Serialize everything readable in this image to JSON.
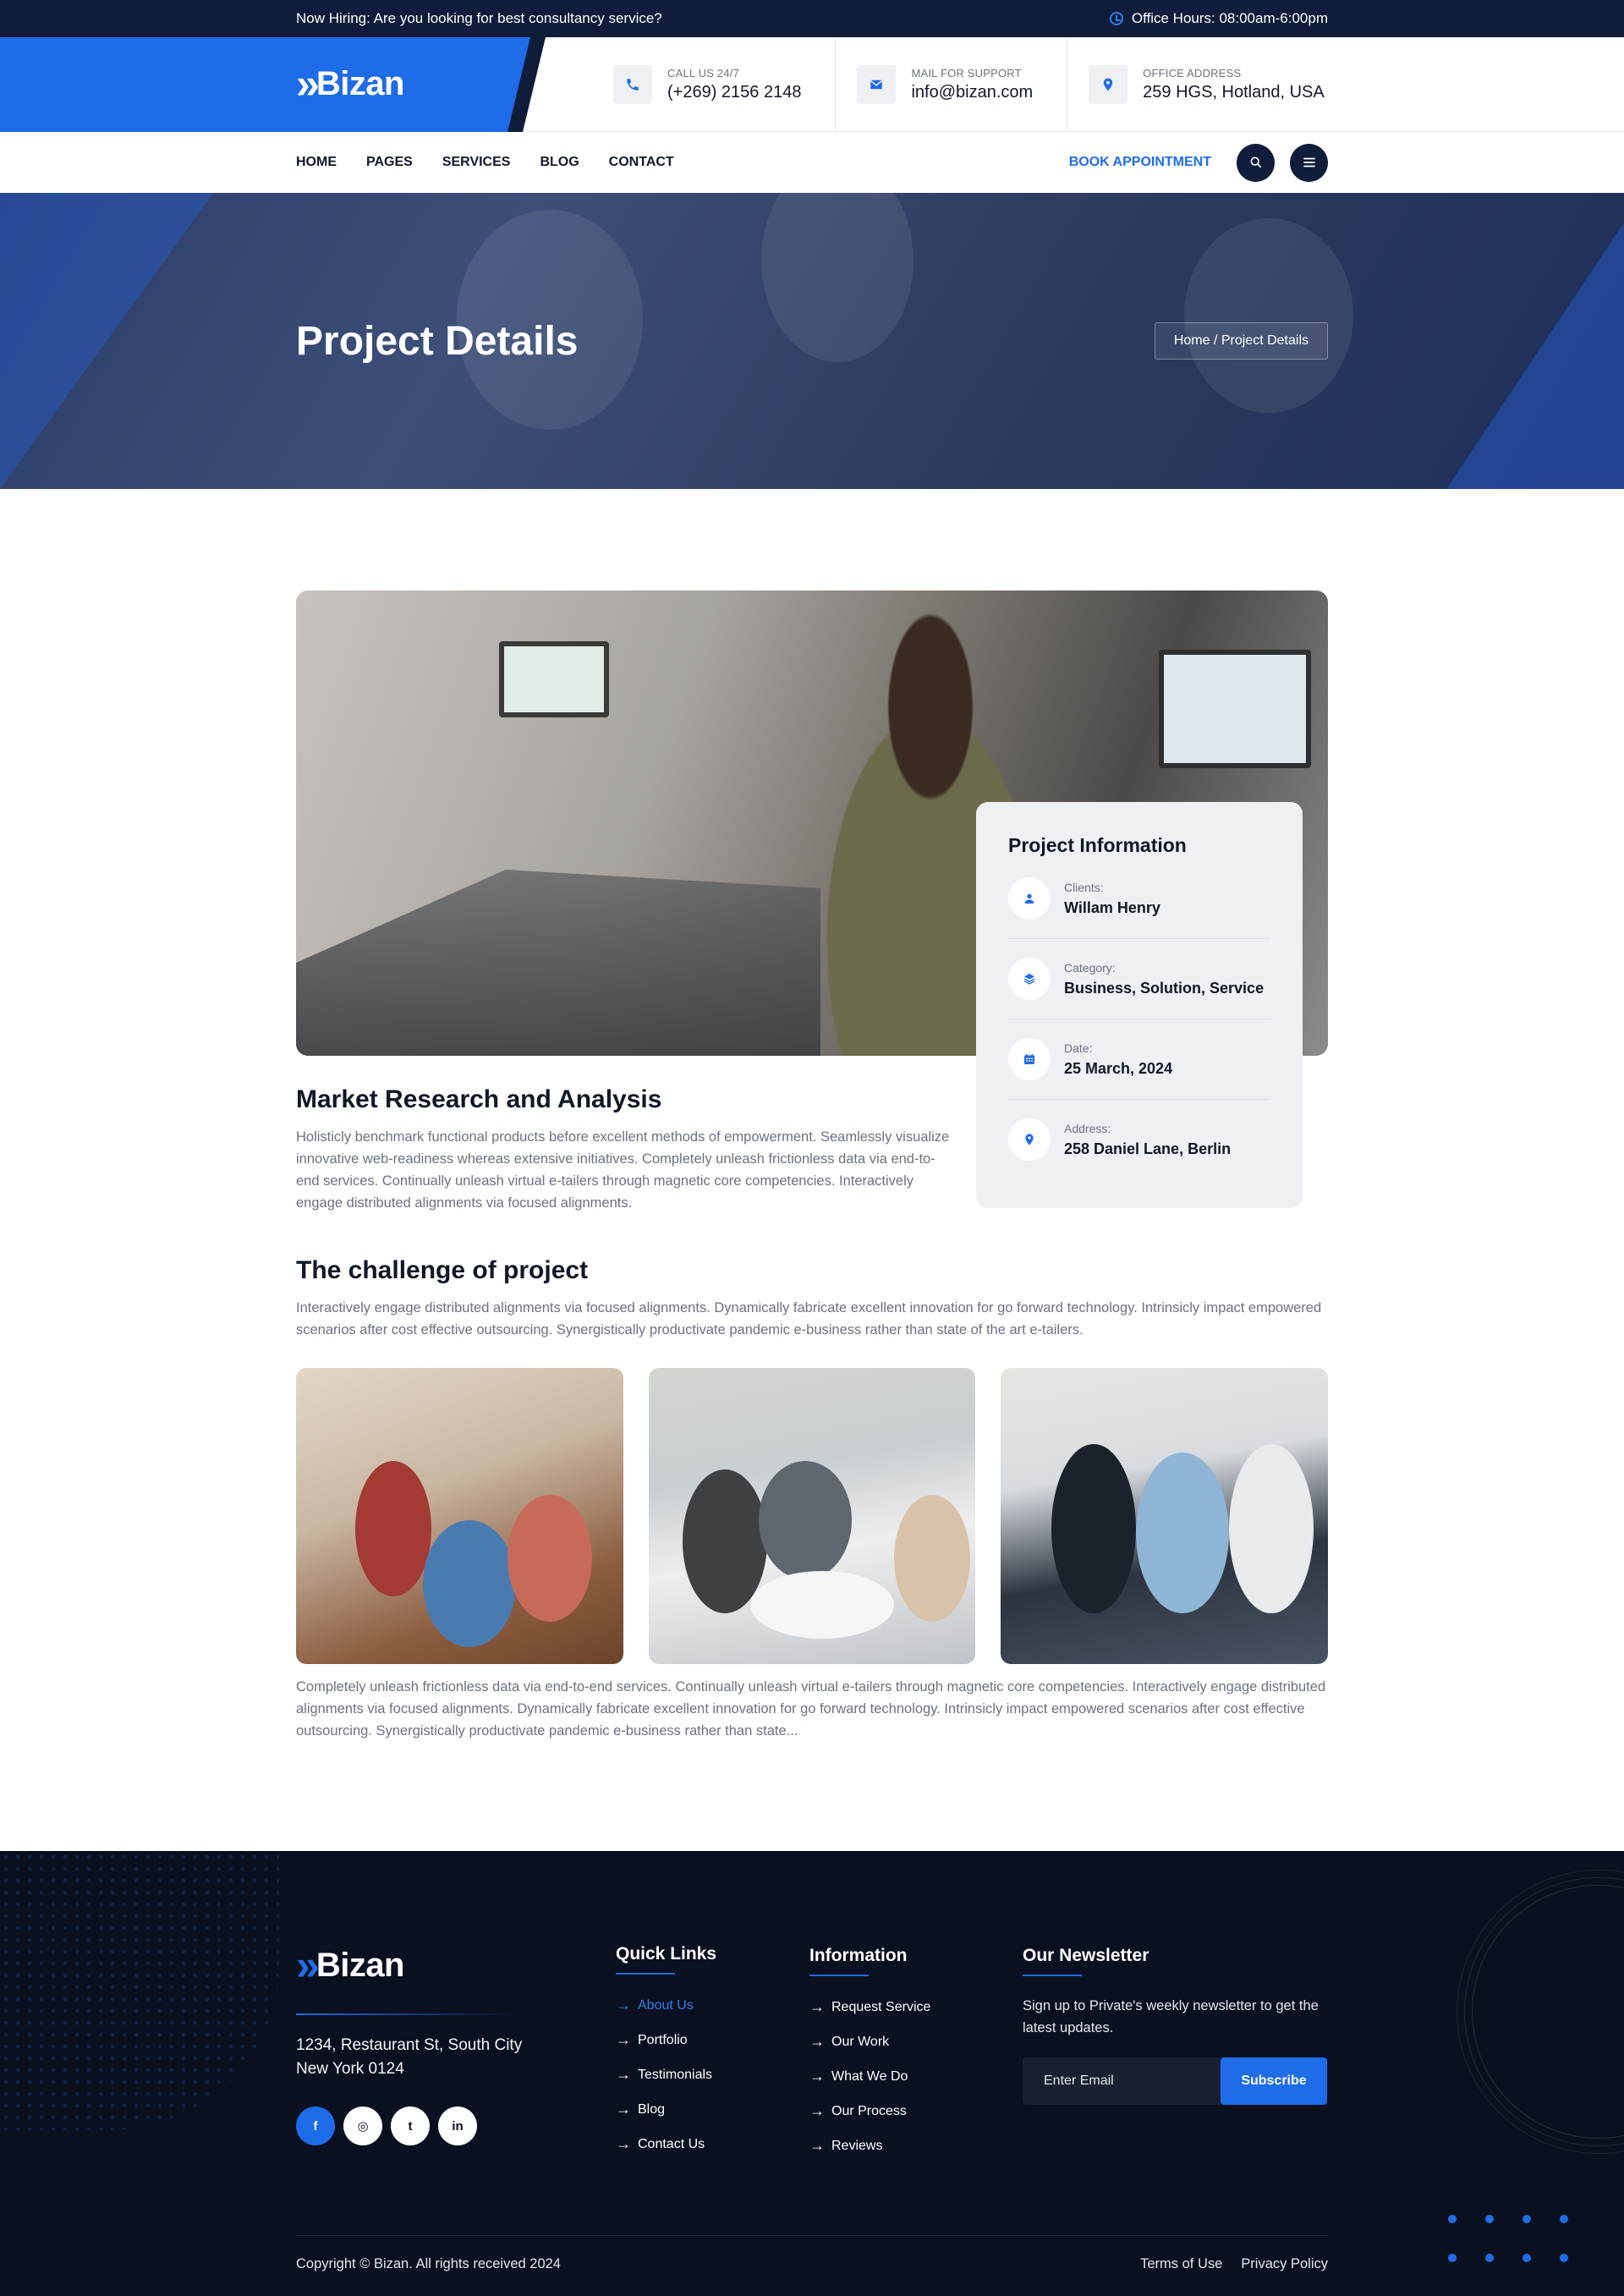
{
  "topbar": {
    "hiring": "Now Hiring: Are you looking for best consultancy service?",
    "hours": "Office Hours: 08:00am-6:00pm"
  },
  "brand": {
    "name": "Bizan",
    "accent": "#1e6ce8",
    "dark": "#0f1d3a"
  },
  "header": {
    "contacts": [
      {
        "icon": "phone-icon",
        "label": "CALL US 24/7",
        "value": "(+269) 2156 2148"
      },
      {
        "icon": "mail-icon",
        "label": "MAIL FOR SUPPORT",
        "value": "info@bizan.com"
      },
      {
        "icon": "location-icon",
        "label": "OFFICE ADDRESS",
        "value": "259 HGS, Hotland, USA"
      }
    ]
  },
  "nav": {
    "items": [
      "HOME",
      "PAGES",
      "SERVICES",
      "BLOG",
      "CONTACT"
    ],
    "cta": "BOOK APPOINTMENT"
  },
  "hero": {
    "title": "Project Details",
    "breadcrumb": "Home / Project Details"
  },
  "project_info": {
    "title": "Project Information",
    "rows": [
      {
        "icon": "user-icon",
        "label": "Clients:",
        "value": "Willam Henry"
      },
      {
        "icon": "layers-icon",
        "label": "Category:",
        "value": "Business, Solution, Service"
      },
      {
        "icon": "calendar-icon",
        "label": "Date:",
        "value": "25 March, 2024"
      },
      {
        "icon": "location-icon",
        "label": "Address:",
        "value": "258 Daniel Lane, Berlin"
      }
    ]
  },
  "main": {
    "heading": "Market Research and Analysis",
    "paragraph": "Holisticly benchmark functional products before excellent methods of empowerment. Seamlessly visualize innovative web-readiness whereas extensive initiatives. Completely unleash frictionless data via end-to-end services. Continually unleash virtual e-tailers through magnetic core competencies. Interactively engage distributed alignments via focused alignments.",
    "challenge_heading": "The challenge of project",
    "challenge_paragraph": "Interactively engage distributed alignments via focused alignments. Dynamically fabricate excellent innovation for go forward technology. Intrinsicly impact empowered scenarios after cost effective outsourcing. Synergistically productivate pandemic e-business rather than state of the art e-tailers.",
    "closing_paragraph": "Completely unleash frictionless data via end-to-end services. Continually unleash virtual e-tailers through magnetic core competencies. Interactively engage distributed alignments via focused alignments. Dynamically fabricate excellent innovation for go forward technology. Intrinsicly impact empowered scenarios after cost effective outsourcing. Synergistically productivate pandemic e-business rather than state..."
  },
  "footer": {
    "address_line1": "1234, Restaurant St, South City",
    "address_line2": "New York 0124",
    "socials": [
      {
        "icon": "facebook-icon",
        "glyph": "f"
      },
      {
        "icon": "instagram-icon",
        "glyph": "◎"
      },
      {
        "icon": "twitter-icon",
        "glyph": "t"
      },
      {
        "icon": "linkedin-icon",
        "glyph": "in"
      }
    ],
    "quick_links_title": "Quick Links",
    "quick_links": [
      "About Us",
      "Portfolio",
      "Testimonials",
      "Blog",
      "Contact Us"
    ],
    "information_title": "Information",
    "information": [
      "Request Service",
      "Our Work",
      "What We Do",
      "Our Process",
      "Reviews"
    ],
    "newsletter_title": "Our Newsletter",
    "newsletter_text": "Sign up to Private's weekly newsletter to get the latest updates.",
    "email_placeholder": "Enter Email",
    "subscribe_label": "Subscribe",
    "copyright": "Copyright © Bizan. All rights received 2024",
    "terms": "Terms of Use",
    "privacy": "Privacy Policy"
  }
}
